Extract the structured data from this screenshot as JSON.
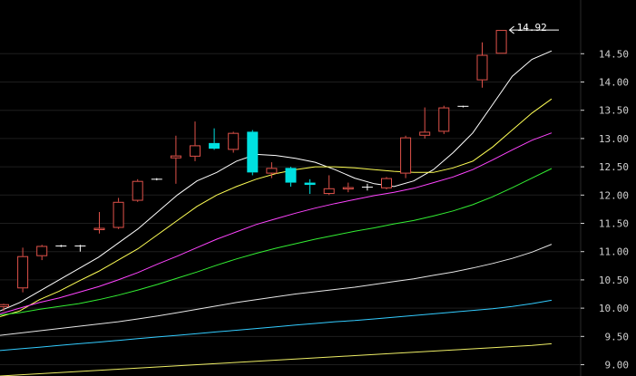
{
  "chart_data": {
    "type": "candlestick",
    "colors": {
      "background": "#000000",
      "up_candle": "#e0524a",
      "down_candle": "#00e0e0",
      "doji": "#ffffff",
      "axis_text": "#d0d0d0",
      "grid": "#1e1e1e",
      "axis_line": "#2a2a2a",
      "callout": "#ffffff"
    },
    "y_axis": {
      "min": 8.8,
      "max": 15.45,
      "ticks": [
        "9.00",
        "9.50",
        "10.00",
        "10.50",
        "11.00",
        "11.50",
        "12.00",
        "12.50",
        "13.00",
        "13.50",
        "14.00",
        "14.50"
      ],
      "side": "right",
      "grid": true
    },
    "high_callout": "14.92",
    "candles": [
      {
        "o": 10.02,
        "h": 10.08,
        "l": 9.95,
        "c": 10.07
      },
      {
        "o": 10.35,
        "h": 11.07,
        "l": 10.28,
        "c": 10.92
      },
      {
        "o": 10.92,
        "h": 11.12,
        "l": 10.85,
        "c": 11.1
      },
      {
        "o": 11.1,
        "h": 11.12,
        "l": 11.08,
        "c": 11.1
      },
      {
        "o": 11.1,
        "h": 11.12,
        "l": 11.0,
        "c": 11.1
      },
      {
        "o": 11.38,
        "h": 11.7,
        "l": 11.32,
        "c": 11.42
      },
      {
        "o": 11.42,
        "h": 11.95,
        "l": 11.4,
        "c": 11.88
      },
      {
        "o": 11.9,
        "h": 12.28,
        "l": 11.88,
        "c": 12.25
      },
      {
        "o": 12.28,
        "h": 12.3,
        "l": 12.26,
        "c": 12.28
      },
      {
        "o": 12.65,
        "h": 13.05,
        "l": 12.2,
        "c": 12.7
      },
      {
        "o": 12.68,
        "h": 13.3,
        "l": 12.6,
        "c": 12.88
      },
      {
        "o": 12.92,
        "h": 13.18,
        "l": 12.8,
        "c": 12.82
      },
      {
        "o": 12.8,
        "h": 13.12,
        "l": 12.75,
        "c": 13.1
      },
      {
        "o": 13.12,
        "h": 13.15,
        "l": 12.35,
        "c": 12.4
      },
      {
        "o": 12.38,
        "h": 12.58,
        "l": 12.3,
        "c": 12.48
      },
      {
        "o": 12.48,
        "h": 12.5,
        "l": 12.15,
        "c": 12.22
      },
      {
        "o": 12.22,
        "h": 12.28,
        "l": 12.02,
        "c": 12.18
      },
      {
        "o": 12.02,
        "h": 12.35,
        "l": 12.0,
        "c": 12.12
      },
      {
        "o": 12.1,
        "h": 12.22,
        "l": 12.05,
        "c": 12.14
      },
      {
        "o": 12.14,
        "h": 12.2,
        "l": 12.08,
        "c": 12.14
      },
      {
        "o": 12.12,
        "h": 12.32,
        "l": 12.1,
        "c": 12.3
      },
      {
        "o": 12.38,
        "h": 13.05,
        "l": 12.3,
        "c": 13.02
      },
      {
        "o": 13.05,
        "h": 13.55,
        "l": 13.0,
        "c": 13.12
      },
      {
        "o": 13.12,
        "h": 13.58,
        "l": 13.08,
        "c": 13.55
      },
      {
        "o": 13.57,
        "h": 13.58,
        "l": 13.55,
        "c": 13.57
      },
      {
        "o": 14.03,
        "h": 14.7,
        "l": 13.9,
        "c": 14.48
      },
      {
        "o": 14.5,
        "h": 14.92,
        "l": 14.5,
        "c": 14.92
      }
    ],
    "moving_averages": [
      {
        "color": "#ffffff",
        "values": [
          9.95,
          10.1,
          10.3,
          10.5,
          10.7,
          10.9,
          11.15,
          11.4,
          11.7,
          12.0,
          12.25,
          12.4,
          12.6,
          12.72,
          12.7,
          12.65,
          12.58,
          12.45,
          12.3,
          12.2,
          12.15,
          12.25,
          12.45,
          12.75,
          13.1,
          13.6,
          14.1,
          14.4,
          14.55
        ]
      },
      {
        "color": "#ffff55",
        "values": [
          9.85,
          9.95,
          10.15,
          10.3,
          10.48,
          10.65,
          10.85,
          11.05,
          11.3,
          11.55,
          11.8,
          12.0,
          12.15,
          12.28,
          12.38,
          12.45,
          12.5,
          12.5,
          12.48,
          12.45,
          12.42,
          12.4,
          12.4,
          12.48,
          12.6,
          12.85,
          13.15,
          13.45,
          13.7
        ]
      },
      {
        "color": "#ff44ff",
        "values": [
          9.9,
          10.0,
          10.1,
          10.18,
          10.28,
          10.38,
          10.5,
          10.63,
          10.78,
          10.92,
          11.07,
          11.22,
          11.35,
          11.48,
          11.58,
          11.68,
          11.77,
          11.85,
          11.92,
          11.99,
          12.05,
          12.12,
          12.22,
          12.32,
          12.45,
          12.62,
          12.8,
          12.97,
          13.1
        ]
      },
      {
        "color": "#33ee33",
        "values": [
          9.88,
          9.92,
          9.98,
          10.03,
          10.08,
          10.15,
          10.23,
          10.32,
          10.42,
          10.53,
          10.64,
          10.76,
          10.87,
          10.97,
          11.06,
          11.14,
          11.22,
          11.29,
          11.36,
          11.42,
          11.49,
          11.55,
          11.63,
          11.72,
          11.83,
          11.97,
          12.13,
          12.3,
          12.47
        ]
      },
      {
        "color": "#e6e6e6",
        "values": [
          9.52,
          9.56,
          9.6,
          9.64,
          9.68,
          9.72,
          9.76,
          9.81,
          9.86,
          9.92,
          9.98,
          10.04,
          10.1,
          10.15,
          10.2,
          10.25,
          10.29,
          10.33,
          10.37,
          10.42,
          10.47,
          10.52,
          10.58,
          10.64,
          10.71,
          10.79,
          10.88,
          10.99,
          11.13
        ]
      },
      {
        "color": "#33ccff",
        "values": [
          9.25,
          9.28,
          9.31,
          9.34,
          9.37,
          9.4,
          9.43,
          9.46,
          9.49,
          9.52,
          9.55,
          9.58,
          9.61,
          9.64,
          9.67,
          9.7,
          9.73,
          9.76,
          9.78,
          9.81,
          9.84,
          9.87,
          9.9,
          9.93,
          9.96,
          9.99,
          10.03,
          10.08,
          10.14
        ]
      },
      {
        "color": "#eeee66",
        "values": [
          8.8,
          8.82,
          8.84,
          8.86,
          8.88,
          8.9,
          8.92,
          8.94,
          8.96,
          8.98,
          9.0,
          9.02,
          9.04,
          9.06,
          9.08,
          9.1,
          9.12,
          9.14,
          9.16,
          9.18,
          9.2,
          9.22,
          9.24,
          9.26,
          9.28,
          9.3,
          9.32,
          9.34,
          9.37
        ]
      }
    ]
  }
}
